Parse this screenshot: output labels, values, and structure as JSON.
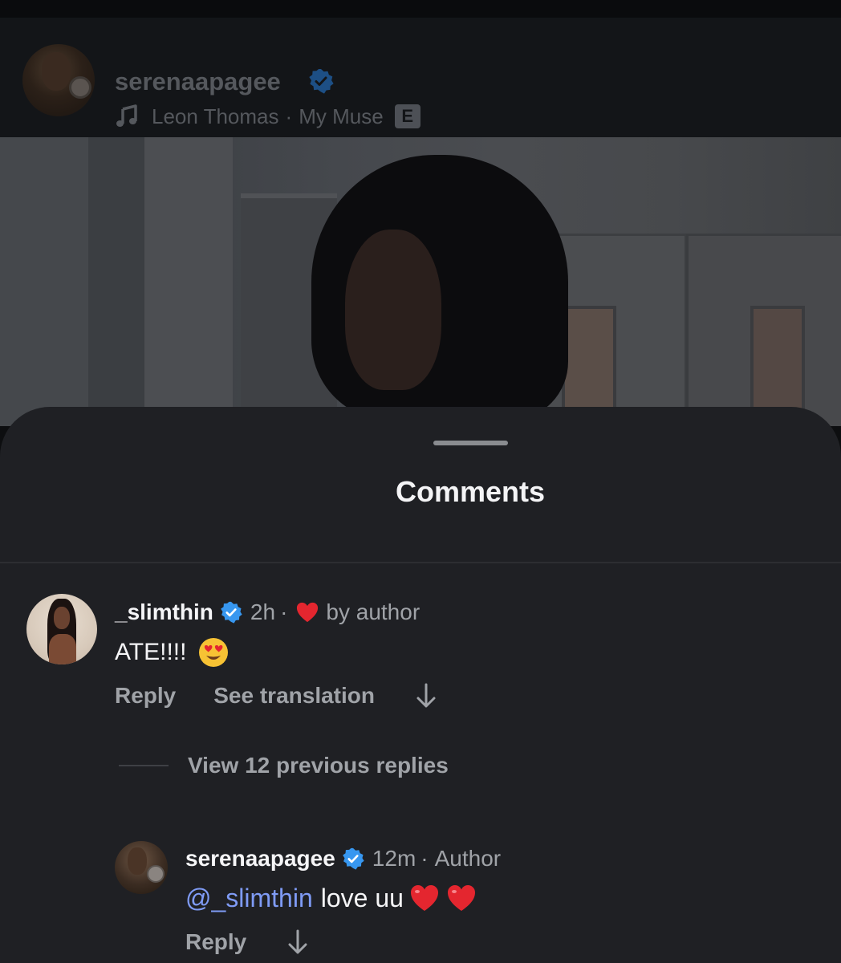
{
  "post_header": {
    "username": "serenaapagee",
    "music_artist": "Leon Thomas",
    "music_separator": "·",
    "music_title": "My Muse",
    "explicit_badge": "E"
  },
  "comments_sheet": {
    "title": "Comments",
    "comments": [
      {
        "username": "_slimthin",
        "verified": true,
        "time": "2h",
        "separator": "·",
        "liked_by_author_label": "by author",
        "text": "ATE!!!!",
        "emoji": "heart-eyes",
        "actions": {
          "reply": "Reply",
          "translate": "See translation"
        }
      }
    ],
    "view_replies_label": "View 12 previous replies",
    "replies": [
      {
        "username": "serenaapagee",
        "verified": true,
        "time": "12m",
        "separator": "·",
        "badge": "Author",
        "mention": "@_slimthin",
        "text": "love uu",
        "emoji": [
          "red-heart",
          "red-heart"
        ],
        "actions": {
          "reply": "Reply"
        }
      }
    ]
  },
  "colors": {
    "sheet_bg": "#1f2024",
    "verified_blue": "#3797f0",
    "mention_blue": "#7f9bf5",
    "heart_red": "#e4262f",
    "muted_text": "#a0a3a8"
  }
}
